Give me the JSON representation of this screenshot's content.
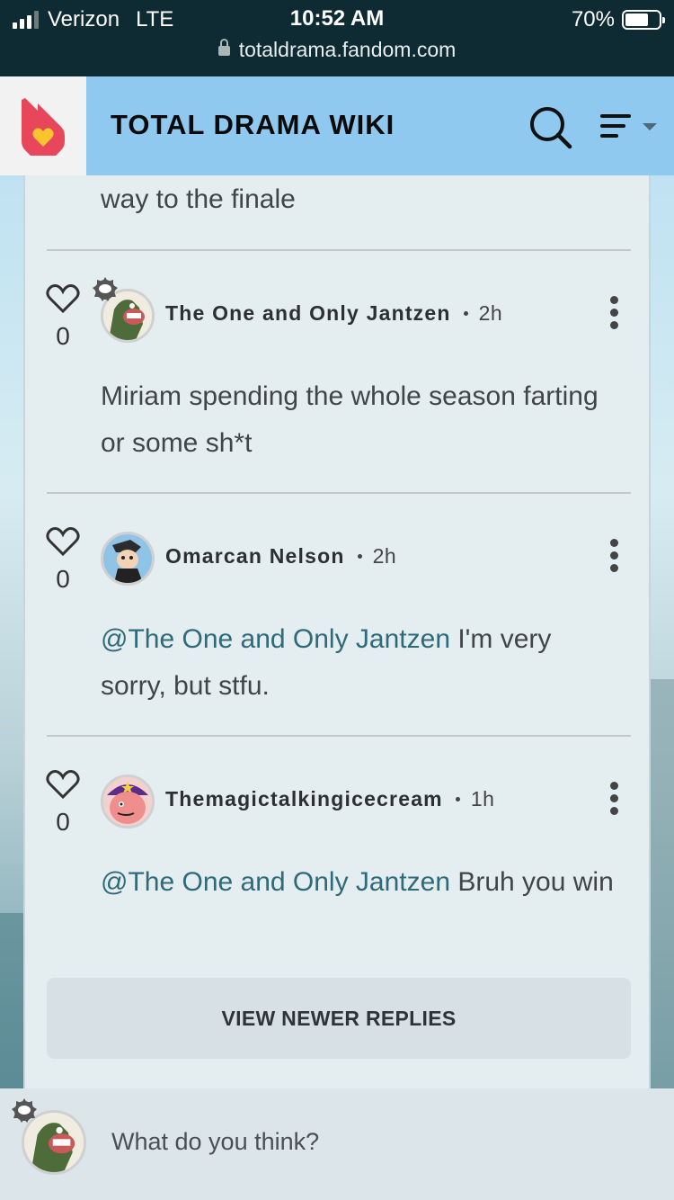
{
  "status_bar": {
    "carrier": "Verizon",
    "network": "LTE",
    "time": "10:52 AM",
    "battery": "70%",
    "battery_level": 0.7,
    "url": "totaldrama.fandom.com"
  },
  "header": {
    "title": "TOTAL DRAMA WIKI"
  },
  "thread": {
    "previous_text": "way to the finale",
    "replies": [
      {
        "likes": "0",
        "author": "The One and Only Jantzen",
        "time": "2h",
        "mention": "",
        "text": "Miriam spending the whole season farting or some sh*t"
      },
      {
        "likes": "0",
        "author": "Omarcan Nelson",
        "time": "2h",
        "mention": "@The One and Only Jantzen",
        "text": " I'm very sorry, but stfu."
      },
      {
        "likes": "0",
        "author": "Themagictalkingicecream",
        "time": "1h",
        "mention": "@The One and Only Jantzen",
        "text": " Bruh you win"
      }
    ],
    "view_newer_label": "VIEW NEWER REPLIES"
  },
  "composer": {
    "placeholder": "What do you think?"
  },
  "colors": {
    "status_bar_bg": "#0e2a33",
    "header_bg": "#8fc9ef",
    "mention": "#2e6a7a",
    "fandom_logo": "#e8475b"
  }
}
